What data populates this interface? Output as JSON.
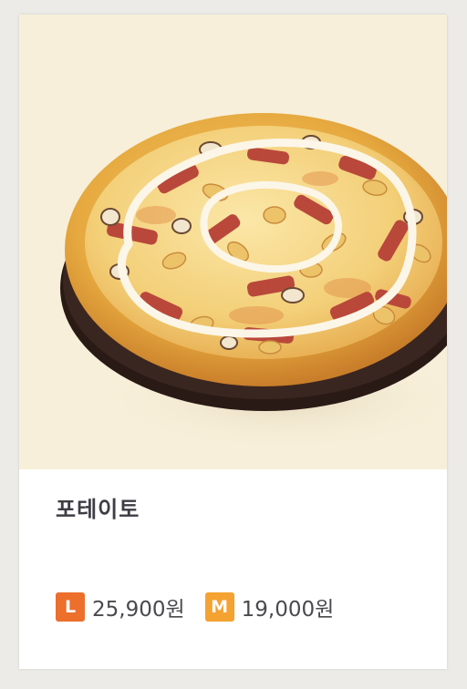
{
  "product": {
    "name": "포테이토",
    "image_alt": "potato pizza photo"
  },
  "prices": [
    {
      "size": "L",
      "price": "25,900원",
      "badge_color": "#ec6f2c"
    },
    {
      "size": "M",
      "price": "19,000원",
      "badge_color": "#f4a232"
    }
  ],
  "colors": {
    "photo_background": "#f7efd9",
    "title_text": "#3d3d44",
    "price_text": "#4a4a4e"
  }
}
